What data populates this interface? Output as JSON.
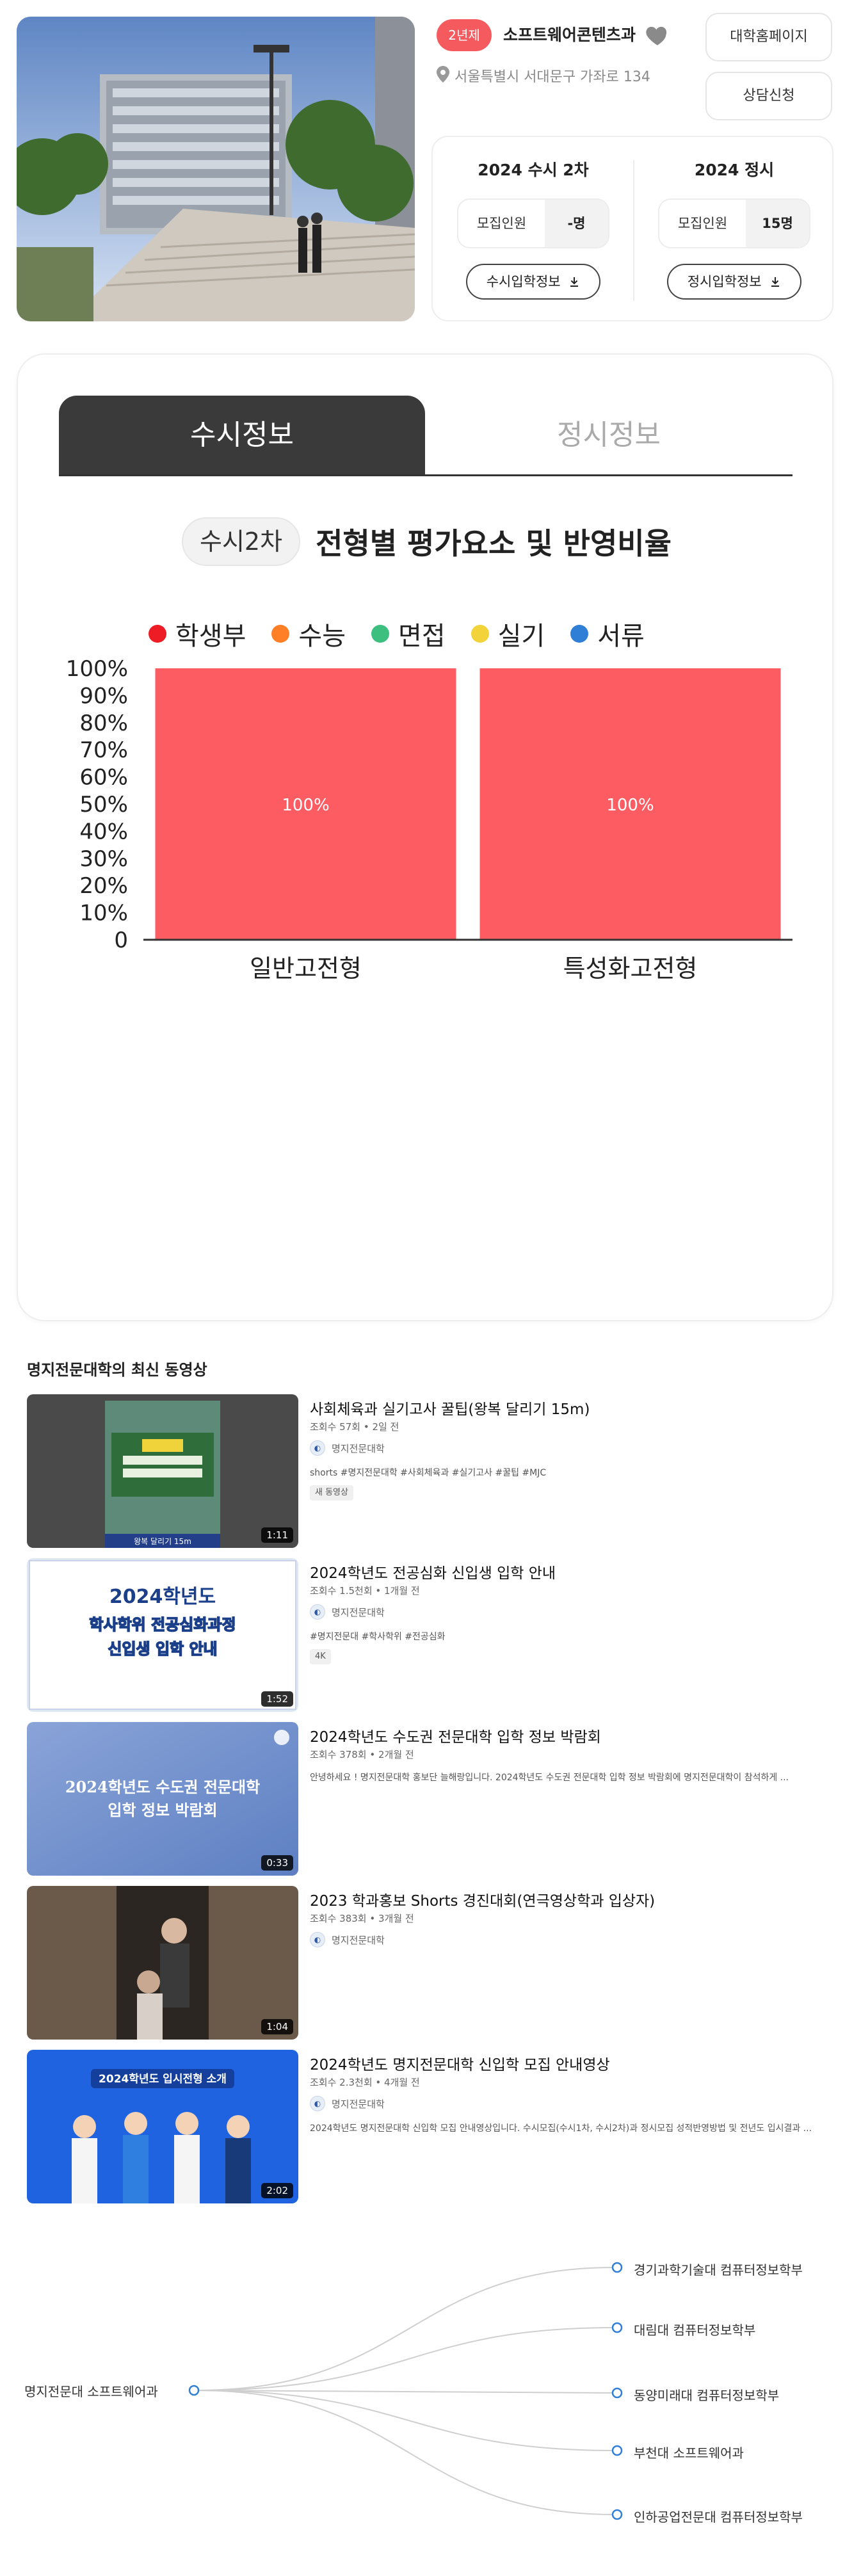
{
  "header": {
    "type_badge": "2년제",
    "dept_name": "소프트웨어콘텐츠과",
    "address": "서울특별시 서대문구 가좌로 134",
    "homepage_button": "대학홈페이지",
    "consult_button": "상담신청",
    "susi": {
      "title": "2024 수시 2차",
      "quota_label": "모집인원",
      "quota_value": "-명",
      "info_button": "수시입학정보"
    },
    "jeongsi": {
      "title": "2024 정시",
      "quota_label": "모집인원",
      "quota_value": "15명",
      "info_button": "정시입학정보"
    }
  },
  "tabs": {
    "active": "수시정보",
    "inactive": "정시정보"
  },
  "chart_section": {
    "pill": "수시2차",
    "title": "전형별 평가요소 및 반영비율"
  },
  "chart_data": {
    "type": "bar",
    "categories": [
      "일반고전형",
      "특성화고전형"
    ],
    "series": [
      {
        "name": "학생부",
        "color": "#ee1c25",
        "values": [
          100,
          100
        ],
        "bar_color": "#fd5c63"
      },
      {
        "name": "수능",
        "color": "#ff7f27",
        "values": [
          0,
          0
        ]
      },
      {
        "name": "면접",
        "color": "#3dbf7f",
        "values": [
          0,
          0
        ]
      },
      {
        "name": "실기",
        "color": "#f2d43a",
        "values": [
          0,
          0
        ]
      },
      {
        "name": "서류",
        "color": "#2f7fd6",
        "values": [
          0,
          0
        ]
      }
    ],
    "data_labels": [
      "100%",
      "100%"
    ],
    "yticks": [
      "0",
      "10%",
      "20%",
      "30%",
      "40%",
      "50%",
      "60%",
      "70%",
      "80%",
      "90%",
      "100%"
    ],
    "ylim": [
      0,
      100
    ],
    "stacked": true,
    "legend_position": "top"
  },
  "videos_section": {
    "title": "명지전문대학의 최신 동영상",
    "items": [
      {
        "title": "사회체육과 실기고사 꿀팁(왕복 달리기 15m)",
        "meta": "조회수 57회 • 2일 전",
        "channel": "명지전문대학",
        "desc": "shorts #명지전문대학 #사회체육과 #실기고사 #꿀팁 #MJC",
        "badge": "새 동영상",
        "duration": "1:11",
        "thumb_text": "왕복 달리기 15m"
      },
      {
        "title": "2024학년도 전공심화 신입생 입학 안내",
        "meta": "조회수 1.5천회 • 1개월 전",
        "channel": "명지전문대학",
        "desc": "#명지전문대 #학사학위 #전공심화",
        "badge": "4K",
        "duration": "1:52",
        "thumb_text_1": "2024학년도",
        "thumb_text_2": "학사학위 전공심화과정",
        "thumb_text_3": "신입생 입학 안내"
      },
      {
        "title": "2024학년도 수도권 전문대학 입학 정보 박람회",
        "meta": "조회수 378회 • 2개월 전",
        "channel": "",
        "desc": "안녕하세요 ! 명지전문대학 홍보단 늘해랑입니다. 2024학년도 수도권 전문대학 입학 정보 박람회에 명지전문대학이 참석하게 ...",
        "badge": "",
        "duration": "0:33",
        "thumb_text_1": "2024학년도 수도권 전문대학",
        "thumb_text_2": "입학 정보 박람회"
      },
      {
        "title": "2023 학과홍보 Shorts 경진대회(연극영상학과 입상자)",
        "meta": "조회수 383회 • 3개월 전",
        "channel": "명지전문대학",
        "desc": "",
        "badge": "",
        "duration": "1:04"
      },
      {
        "title": "2024학년도 명지전문대학 신입학 모집 안내영상",
        "meta": "조회수 2.3천회 • 4개월 전",
        "channel": "명지전문대학",
        "desc": "2024학년도 명지전문대학 신입학 모집 안내영상입니다. 수시모집(수시1차, 수시2차)과 정시모집 성적반영방법 및 전년도 입시결과 ...",
        "badge": "",
        "duration": "2:02",
        "thumb_text": "2024학년도 입시전형 소개"
      }
    ]
  },
  "related_map": {
    "root": "명지전문대 소프트웨어과",
    "children": [
      "경기과학기술대 컴퓨터정보학부",
      "대림대 컴퓨터정보학부",
      "동양미래대 컴퓨터정보학부",
      "부천대 소프트웨어과",
      "인하공업전문대 컴퓨터정보학부"
    ]
  },
  "colors": {
    "accent": "#f55b5e",
    "dark_tab": "#3a3a3a",
    "bar": "#fd5c63"
  }
}
